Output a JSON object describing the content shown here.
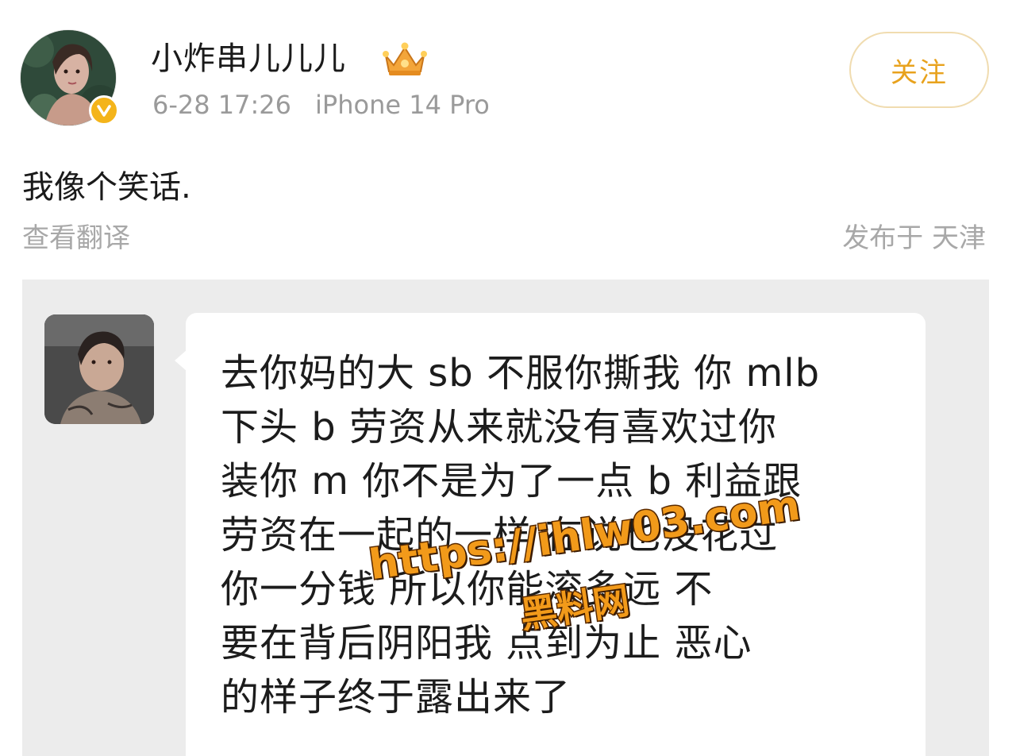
{
  "post": {
    "username": "小炸串儿儿儿",
    "date": "6-28 17:26",
    "device": "iPhone 14 Pro",
    "follow_label": "关注",
    "text": "我像个笑话.",
    "translate_label": "查看翻译",
    "location": "发布于 天津",
    "badge_icon": "verified-v-icon",
    "member_icon": "crown-icon"
  },
  "screenshot": {
    "message_lines": [
      "去你妈的大 sb 不服你撕我 你 mlb",
      "下头 b 劳资从来就没有喜欢过你",
      "装你 m 你不是为了一点 b 利益跟",
      "劳资在一起的一样 在说也没花过",
      "你一分钱 所以你能滚多远 不",
      "要在背后阴阳我 点到为止 恶心",
      "的样子终于露出来了"
    ]
  },
  "watermark": {
    "url": "https://ihlw03.com",
    "name": "黑料网"
  },
  "colors": {
    "accent": "#e8a21d",
    "follow_border": "#f0dcb0",
    "muted_text": "#9a9a9a",
    "panel_bg": "#ececec",
    "watermark": "#f29a1a"
  }
}
